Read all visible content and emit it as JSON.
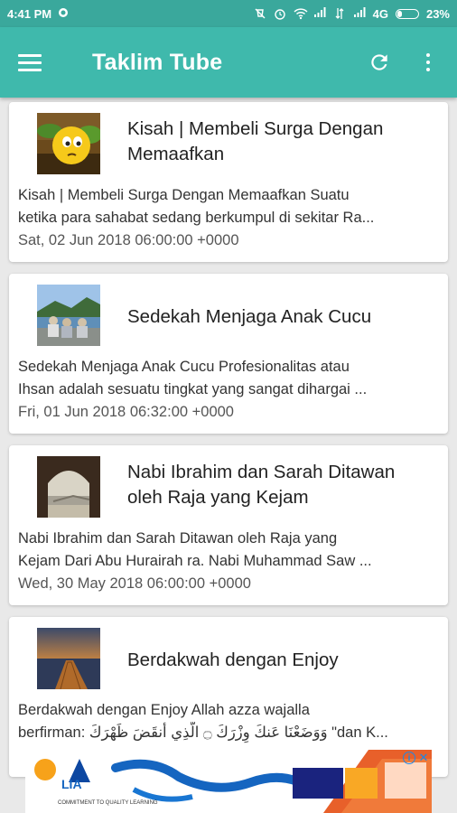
{
  "status_bar": {
    "time": "4:41 PM",
    "network": "4G",
    "battery_percent": "23%",
    "battery_level": 0.23
  },
  "app_bar": {
    "title": "Taklim Tube"
  },
  "feed": [
    {
      "title": "Kisah | Membeli Surga Dengan Memaafkan",
      "desc_lines": [
        "Kisah | Membeli Surga Dengan Memaafkan   Suatu",
        "ketika para sahabat sedang berkumpul di sekitar Ra..."
      ],
      "date": "Sat, 02 Jun 2018 06:00:00 +0000"
    },
    {
      "title": "Sedekah Menjaga Anak Cucu",
      "desc_lines": [
        "Sedekah Menjaga Anak Cucu   Profesionalitas atau",
        "Ihsan adalah sesuatu tingkat yang sangat dihargai ..."
      ],
      "date": "Fri, 01 Jun 2018 06:32:00 +0000"
    },
    {
      "title": "Nabi Ibrahim dan Sarah Ditawan oleh Raja yang Kejam",
      "desc_lines": [
        "Nabi Ibrahim dan Sarah   Ditawan oleh Raja yang",
        "Kejam   Dari Abu Hurairah ra. Nabi Muhammad Saw ..."
      ],
      "date": "Wed, 30 May 2018 06:00:00 +0000"
    },
    {
      "title": "Berdakwah dengan Enjoy",
      "desc_lines": [
        "Berdakwah dengan Enjoy   Allah azza wajalla",
        "berfirman:  وَوَضَعْنَا عَنكَ وِزْرَكَ ۝ الَّذِي أَنقَضَ ظَهْرَكَ  \"dan K..."
      ],
      "date": ""
    }
  ],
  "ad": {
    "logo_text": "LIA",
    "tagline": "COMMITMENT TO QUALITY LEARNING",
    "info_icon": "info-icon",
    "close_icon": "close-icon"
  },
  "colors": {
    "status_bar": "#3aa89c",
    "app_bar": "#3fb9ac",
    "background": "#e9e9e9"
  }
}
